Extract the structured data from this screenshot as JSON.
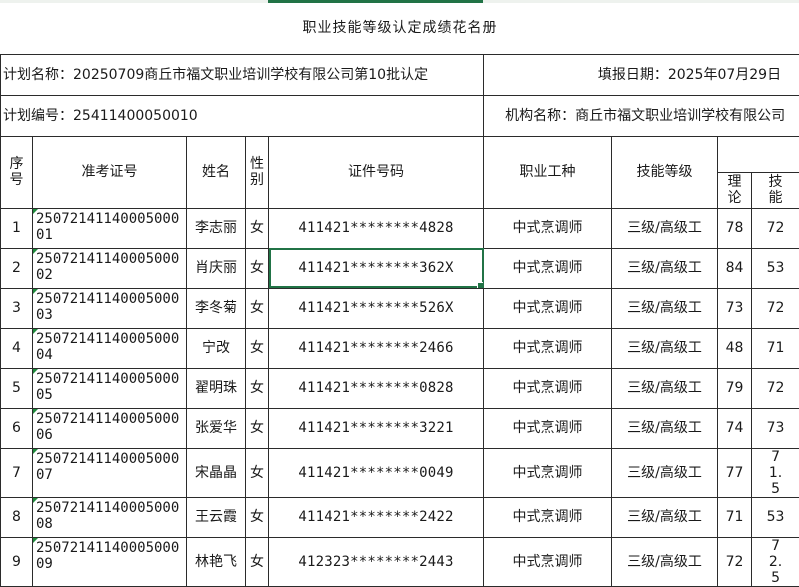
{
  "title": "职业技能等级认定成绩花名册",
  "plan_name_label": "计划名称：",
  "plan_name_value": "20250709商丘市福文职业培训学校有限公司第10批认定",
  "fill_date_label": "填报日期：",
  "fill_date_value": "2025年07月29日",
  "plan_no_label": "计划编号：",
  "plan_no_value": "25411400050010",
  "org_label": "机构名称：",
  "org_value": "商丘市福文职业培训学校有限公司",
  "headers": {
    "seq": "序号",
    "exam_no": "准考证号",
    "name": "姓名",
    "gender": "性别",
    "id_no": "证件号码",
    "occupation": "职业工种",
    "level": "技能等级",
    "theory": "理论",
    "skill": "技能"
  },
  "rows": [
    {
      "seq": "1",
      "exam_no": "2507214114000500001",
      "name": "李志丽",
      "gender": "女",
      "id_no": "411421********4828",
      "occupation": "中式烹调师",
      "level": "三级/高级工",
      "theory": "78",
      "skill": "72"
    },
    {
      "seq": "2",
      "exam_no": "2507214114000500002",
      "name": "肖庆丽",
      "gender": "女",
      "id_no": "411421********362X",
      "occupation": "中式烹调师",
      "level": "三级/高级工",
      "theory": "84",
      "skill": "53"
    },
    {
      "seq": "3",
      "exam_no": "2507214114000500003",
      "name": "李冬菊",
      "gender": "女",
      "id_no": "411421********526X",
      "occupation": "中式烹调师",
      "level": "三级/高级工",
      "theory": "73",
      "skill": "72"
    },
    {
      "seq": "4",
      "exam_no": "2507214114000500004",
      "name": "宁改",
      "gender": "女",
      "id_no": "411421********2466",
      "occupation": "中式烹调师",
      "level": "三级/高级工",
      "theory": "48",
      "skill": "71"
    },
    {
      "seq": "5",
      "exam_no": "2507214114000500005",
      "name": "翟明珠",
      "gender": "女",
      "id_no": "411421********0828",
      "occupation": "中式烹调师",
      "level": "三级/高级工",
      "theory": "79",
      "skill": "72"
    },
    {
      "seq": "6",
      "exam_no": "2507214114000500006",
      "name": "张爱华",
      "gender": "女",
      "id_no": "411421********3221",
      "occupation": "中式烹调师",
      "level": "三级/高级工",
      "theory": "74",
      "skill": "73"
    },
    {
      "seq": "7",
      "exam_no": "2507214114000500007",
      "name": "宋晶晶",
      "gender": "女",
      "id_no": "411421********0049",
      "occupation": "中式烹调师",
      "level": "三级/高级工",
      "theory": "77",
      "skill": "71.5"
    },
    {
      "seq": "8",
      "exam_no": "2507214114000500008",
      "name": "王云霞",
      "gender": "女",
      "id_no": "411421********2422",
      "occupation": "中式烹调师",
      "level": "三级/高级工",
      "theory": "71",
      "skill": "53"
    },
    {
      "seq": "9",
      "exam_no": "2507214114000500009",
      "name": "林艳飞",
      "gender": "女",
      "id_no": "412323********2443",
      "occupation": "中式烹调师",
      "level": "三级/高级工",
      "theory": "72",
      "skill": "72.5"
    }
  ],
  "colors": {
    "selection": "#217346",
    "error_marker": "#1e8a3c",
    "grid_line": "#2b2b2b"
  }
}
